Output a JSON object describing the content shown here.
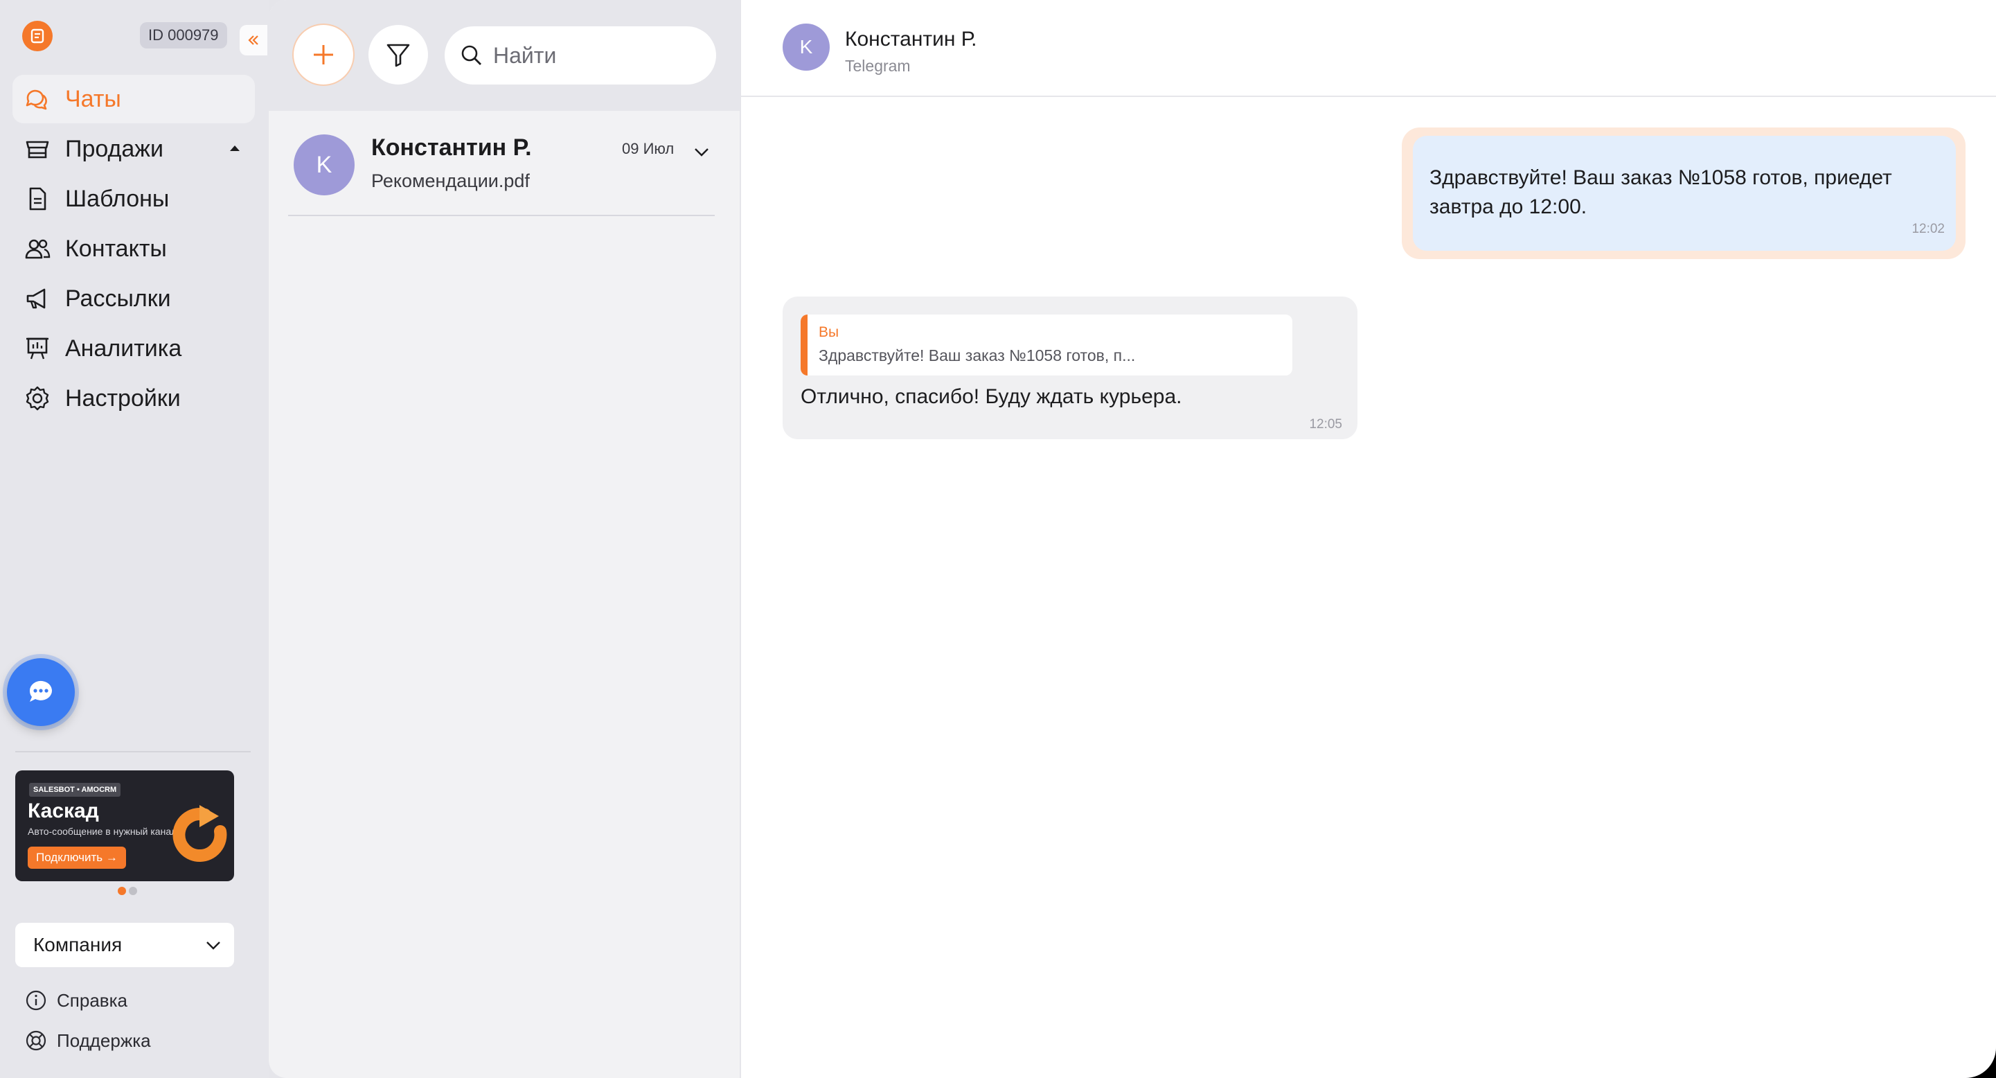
{
  "app": {
    "account_id": "ID 000979",
    "brand_color": "#f5782a"
  },
  "sidebar": {
    "items": [
      {
        "label": "Чаты",
        "icon": "chats-icon",
        "active": true
      },
      {
        "label": "Продажи",
        "icon": "store-icon",
        "expandable": true
      },
      {
        "label": "Шаблоны",
        "icon": "document-icon"
      },
      {
        "label": "Контакты",
        "icon": "contacts-icon"
      },
      {
        "label": "Рассылки",
        "icon": "megaphone-icon"
      },
      {
        "label": "Аналитика",
        "icon": "analytics-icon"
      },
      {
        "label": "Настройки",
        "icon": "gear-icon"
      }
    ],
    "banner": {
      "tag": "SALESBOT • AMOCRM",
      "title": "Каскад",
      "subtitle": "Авто-сообщение в нужный канал",
      "button": "Подключить →"
    },
    "company_select": "Компания",
    "help_label": "Справка",
    "support_label": "Поддержка"
  },
  "chat_list": {
    "search_placeholder": "Найти",
    "chats": [
      {
        "name": "Константин Р.",
        "initial": "K",
        "last_message": "Рекомендации.pdf",
        "date": "09 Июл"
      }
    ]
  },
  "conversation": {
    "contact_name": "Константин Р.",
    "initial": "K",
    "channel": "Telegram",
    "messages": [
      {
        "direction": "out",
        "text": "Здравствуйте! Ваш заказ №1058 готов, приедет завтра до 12:00.",
        "time": "12:02"
      },
      {
        "direction": "in",
        "reply_to_author": "Вы",
        "reply_to_text": "Здравствуйте! Ваш заказ №1058 готов, п...",
        "text": "Отлично, спасибо! Буду ждать курьера.",
        "time": "12:05"
      }
    ]
  }
}
